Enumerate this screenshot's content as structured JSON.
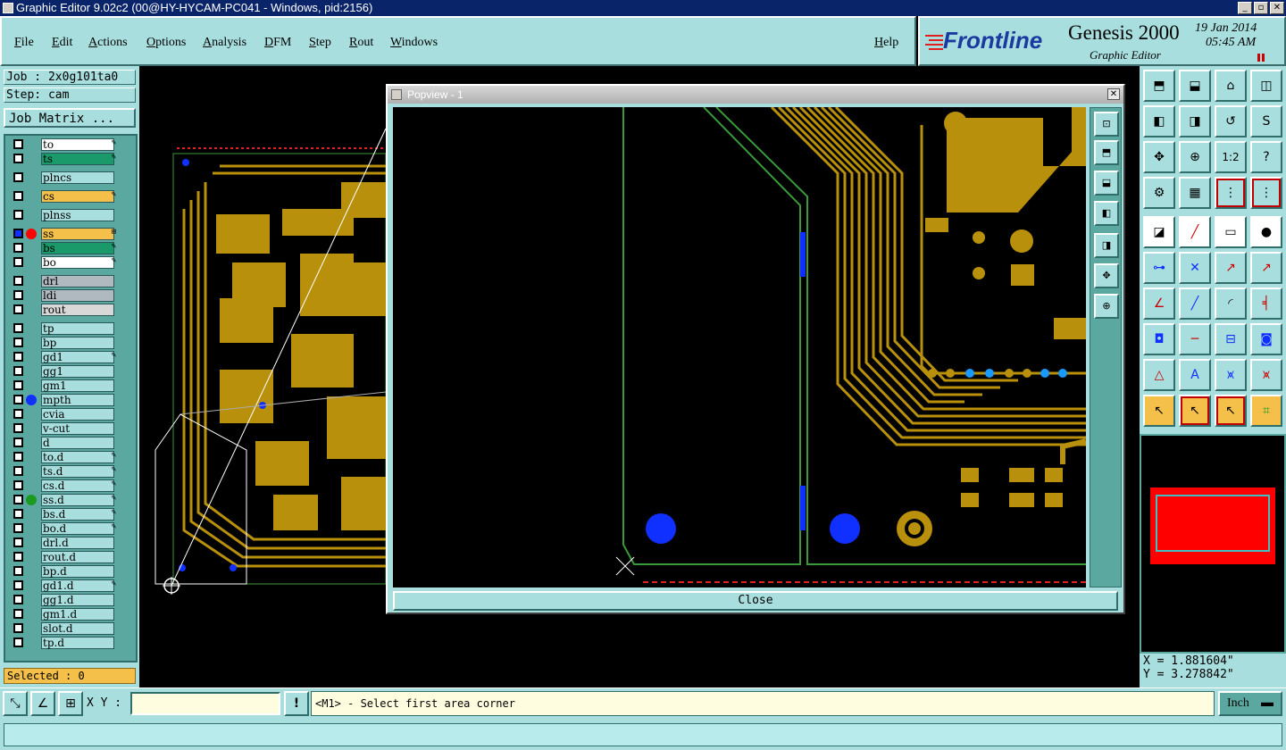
{
  "window": {
    "title": "Graphic Editor 9.02c2 (00@HY-HYCAM-PC041 - Windows, pid:2156)"
  },
  "menu": {
    "items": [
      "File",
      "Edit",
      "Actions",
      "Options",
      "Analysis",
      "DFM",
      "Step",
      "Rout",
      "Windows"
    ],
    "help": "Help"
  },
  "brand": {
    "logo": "Frontline",
    "product": "Genesis 2000",
    "subtitle": "Graphic Editor",
    "date": "19 Jan 2014",
    "time": "05:45 AM"
  },
  "job": {
    "label": "Job : 2x0g101ta0",
    "step": "Step: cam",
    "matrix_button": "Job Matrix ..."
  },
  "layers": [
    {
      "name": "to",
      "color": "#ffffff",
      "mark": "✎",
      "dot": ""
    },
    {
      "name": "ts",
      "color": "#1a9a6a",
      "mark": "✎",
      "dot": ""
    },
    {
      "name": "plncs",
      "color": "#a8dede",
      "mark": "",
      "dot": ""
    },
    {
      "name": "cs",
      "color": "#f5c04a",
      "mark": "✎",
      "dot": ""
    },
    {
      "name": "plnss",
      "color": "#a8dede",
      "mark": "",
      "dot": ""
    },
    {
      "name": "ss",
      "color": "#f5c04a",
      "mark": "⊞",
      "dot": "#ff0000"
    },
    {
      "name": "bs",
      "color": "#1a9a6a",
      "mark": "✎",
      "dot": ""
    },
    {
      "name": "bo",
      "color": "#ffffff",
      "mark": "✎",
      "dot": ""
    },
    {
      "name": "drl",
      "color": "#b0b8c0",
      "mark": "",
      "dot": ""
    },
    {
      "name": "ldi",
      "color": "#b0b8c0",
      "mark": "",
      "dot": ""
    },
    {
      "name": "rout",
      "color": "#d8d8d8",
      "mark": "",
      "dot": ""
    },
    {
      "name": "tp",
      "color": "#a8dede",
      "mark": "",
      "dot": ""
    },
    {
      "name": "bp",
      "color": "#a8dede",
      "mark": "",
      "dot": ""
    },
    {
      "name": "gd1",
      "color": "#a8dede",
      "mark": "✎",
      "dot": ""
    },
    {
      "name": "gg1",
      "color": "#a8dede",
      "mark": "",
      "dot": ""
    },
    {
      "name": "gm1",
      "color": "#a8dede",
      "mark": "",
      "dot": ""
    },
    {
      "name": "mpth",
      "color": "#a8dede",
      "mark": "",
      "dot": "#1030ff"
    },
    {
      "name": "cvia",
      "color": "#a8dede",
      "mark": "",
      "dot": ""
    },
    {
      "name": "v-cut",
      "color": "#a8dede",
      "mark": "",
      "dot": ""
    },
    {
      "name": "d",
      "color": "#a8dede",
      "mark": "",
      "dot": ""
    },
    {
      "name": "to.d",
      "color": "#a8dede",
      "mark": "✎",
      "dot": ""
    },
    {
      "name": "ts.d",
      "color": "#a8dede",
      "mark": "✎",
      "dot": ""
    },
    {
      "name": "cs.d",
      "color": "#a8dede",
      "mark": "✎",
      "dot": ""
    },
    {
      "name": "ss.d",
      "color": "#a8dede",
      "mark": "✎",
      "dot": "#1a9a20"
    },
    {
      "name": "bs.d",
      "color": "#a8dede",
      "mark": "✎",
      "dot": ""
    },
    {
      "name": "bo.d",
      "color": "#a8dede",
      "mark": "✎",
      "dot": ""
    },
    {
      "name": "drl.d",
      "color": "#a8dede",
      "mark": "",
      "dot": ""
    },
    {
      "name": "rout.d",
      "color": "#a8dede",
      "mark": "",
      "dot": ""
    },
    {
      "name": "bp.d",
      "color": "#a8dede",
      "mark": "",
      "dot": ""
    },
    {
      "name": "gd1.d",
      "color": "#a8dede",
      "mark": "✎",
      "dot": ""
    },
    {
      "name": "gg1.d",
      "color": "#a8dede",
      "mark": "",
      "dot": ""
    },
    {
      "name": "gm1.d",
      "color": "#a8dede",
      "mark": "",
      "dot": ""
    },
    {
      "name": "slot.d",
      "color": "#a8dede",
      "mark": "",
      "dot": ""
    },
    {
      "name": "tp.d",
      "color": "#a8dede",
      "mark": "",
      "dot": ""
    }
  ],
  "selected": "Selected : 0",
  "popview": {
    "title": "Popview - 1",
    "close_label": "Close"
  },
  "coords": {
    "x": "X = 1.881604\"",
    "y": "Y = 3.278842\""
  },
  "command": {
    "xy_label": "X Y :",
    "xy_value": "",
    "prompt": "<M1> - Select first area corner",
    "unit": "Inch"
  },
  "colors": {
    "panel": "#a8dede",
    "copper": "#b8900c",
    "pad_blue": "#1030ff",
    "outline_green": "#3a9a3a"
  }
}
